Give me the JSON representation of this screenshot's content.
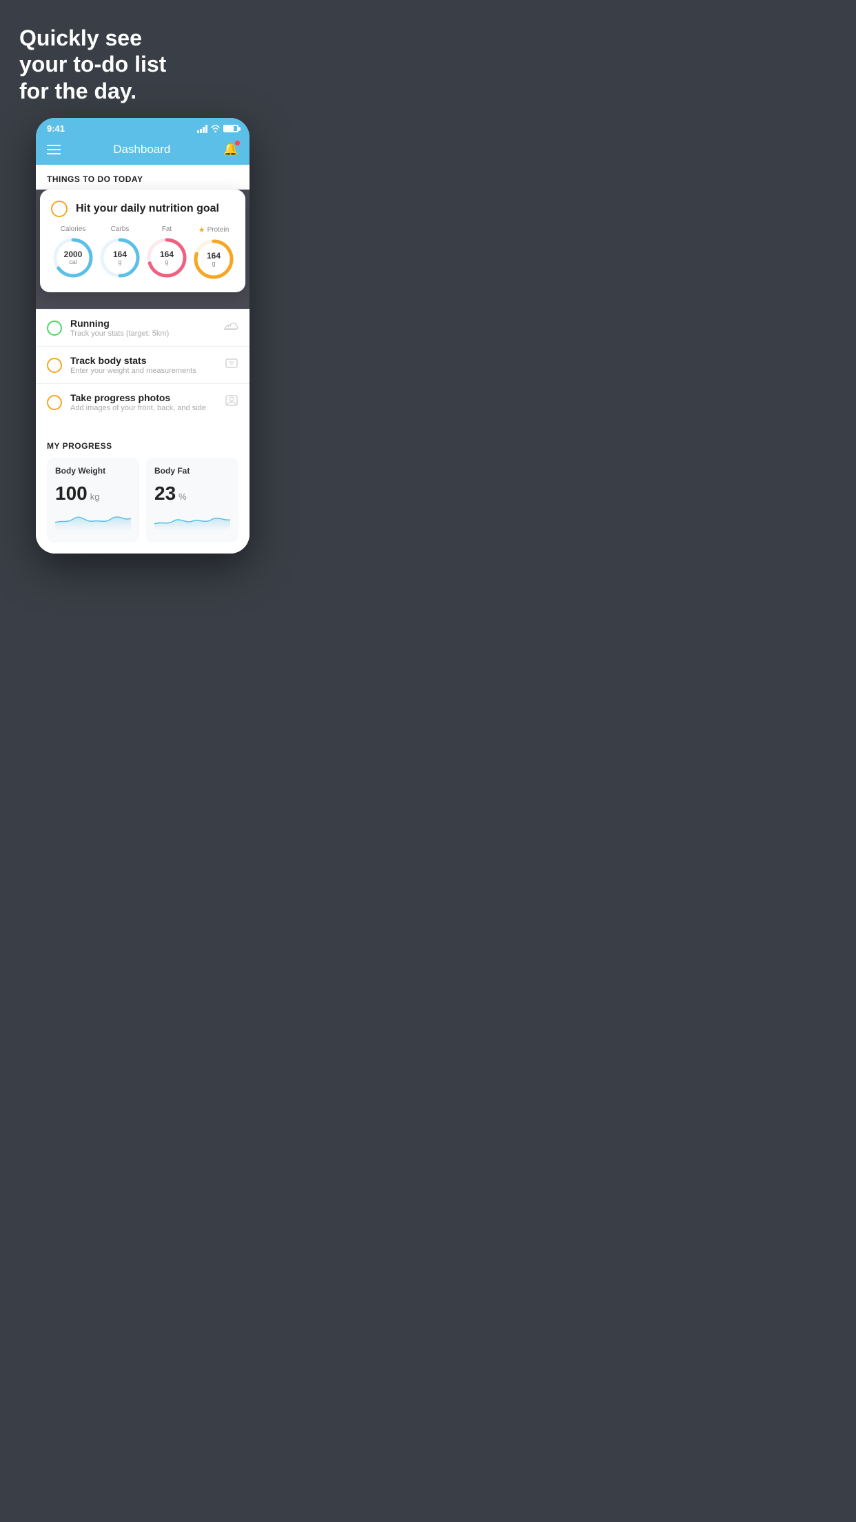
{
  "hero": {
    "title": "Quickly see\nyour to-do list\nfor the day."
  },
  "status_bar": {
    "time": "9:41"
  },
  "nav": {
    "title": "Dashboard"
  },
  "things_section": {
    "label": "THINGS TO DO TODAY"
  },
  "nutrition_card": {
    "title": "Hit your daily nutrition goal",
    "items": [
      {
        "label": "Calories",
        "value": "2000",
        "unit": "cal",
        "color": "#5bbfe8",
        "pct": 65
      },
      {
        "label": "Carbs",
        "value": "164",
        "unit": "g",
        "color": "#5bbfe8",
        "pct": 50
      },
      {
        "label": "Fat",
        "value": "164",
        "unit": "g",
        "color": "#f06080",
        "pct": 70
      },
      {
        "label": "Protein",
        "value": "164",
        "unit": "g",
        "color": "#f5a623",
        "pct": 80,
        "starred": true
      }
    ]
  },
  "todo_items": [
    {
      "id": "running",
      "title": "Running",
      "subtitle": "Track your stats (target: 5km)",
      "check_color": "green",
      "icon": "shoe"
    },
    {
      "id": "body-stats",
      "title": "Track body stats",
      "subtitle": "Enter your weight and measurements",
      "check_color": "yellow",
      "icon": "scale"
    },
    {
      "id": "photos",
      "title": "Take progress photos",
      "subtitle": "Add images of your front, back, and side",
      "check_color": "yellow",
      "icon": "person"
    }
  ],
  "progress_section": {
    "label": "MY PROGRESS",
    "cards": [
      {
        "title": "Body Weight",
        "value": "100",
        "unit": "kg",
        "sparkline": [
          12,
          10,
          14,
          8,
          11,
          9,
          13,
          10,
          8,
          12
        ]
      },
      {
        "title": "Body Fat",
        "value": "23",
        "unit": "%",
        "sparkline": [
          10,
          13,
          11,
          14,
          9,
          12,
          10,
          13,
          11,
          12
        ]
      }
    ]
  }
}
